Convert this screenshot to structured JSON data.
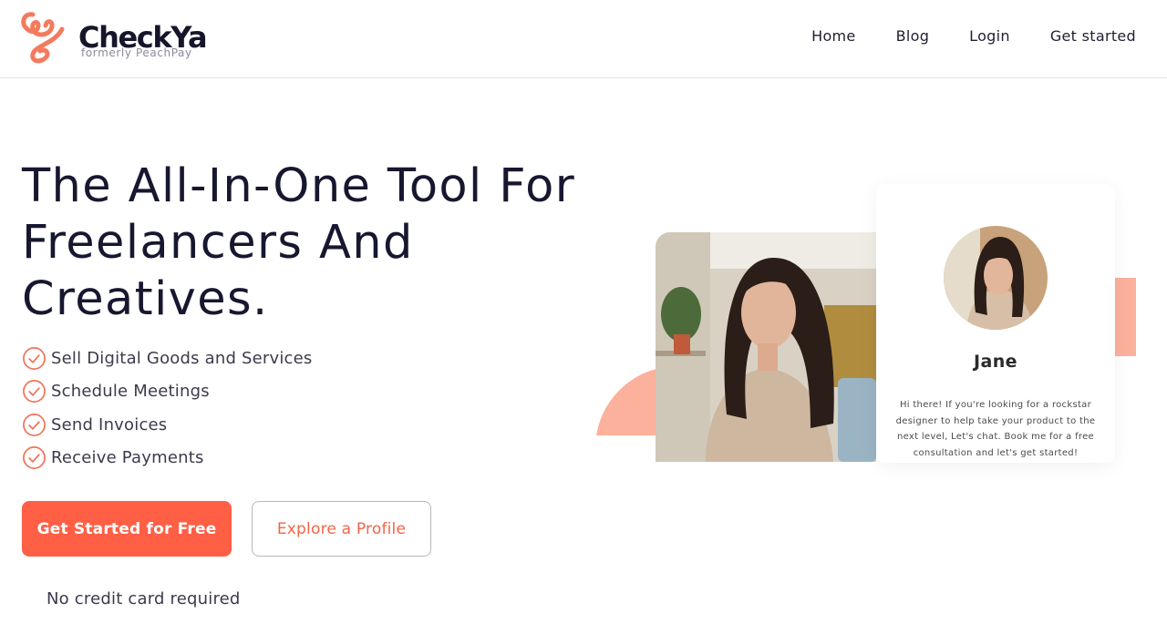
{
  "brand": {
    "name": "CheckYa",
    "tagline": "formerly PeachPay",
    "accent_color": "#ff5f45",
    "peach_color": "#fbb19c"
  },
  "nav": {
    "items": [
      {
        "label": "Home"
      },
      {
        "label": "Blog"
      },
      {
        "label": "Login"
      },
      {
        "label": "Get started"
      }
    ]
  },
  "hero": {
    "title": "The All-In-One Tool For Freelancers And Creatives.",
    "features": [
      {
        "label": "Sell Digital Goods and Services",
        "icon": "check-circle-icon"
      },
      {
        "label": "Schedule Meetings",
        "icon": "check-circle-icon"
      },
      {
        "label": "Send Invoices",
        "icon": "check-circle-icon"
      },
      {
        "label": "Receive Payments",
        "icon": "check-circle-icon"
      }
    ],
    "primary_cta": "Get Started for Free",
    "secondary_cta": "Explore a Profile",
    "note": "No credit card required"
  },
  "profile_card": {
    "name": "Jane",
    "bio": "Hi there!   If you're looking for a rockstar designer to help take your product to the next level, Let's chat. Book me for a free consultation and let's get started!"
  }
}
